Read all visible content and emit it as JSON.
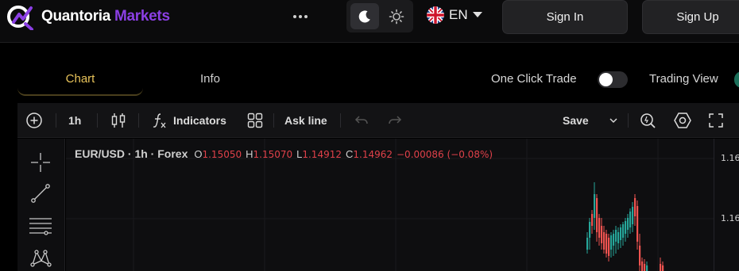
{
  "brand": {
    "name_white": "Quantoria",
    "name_purple": " Markets",
    "accent_purple": "#8b3fe4",
    "accent_gold": "#e8c35a"
  },
  "header": {
    "more_icon": "more-horizontal-icon",
    "theme": {
      "dark_icon": "moon-icon",
      "light_icon": "sun-icon",
      "active": "dark"
    },
    "language": {
      "flag_icon": "uk-flag-icon",
      "label": "EN",
      "caret_icon": "caret-down-icon"
    },
    "sign_in": "Sign In",
    "sign_up": "Sign Up"
  },
  "tabs": [
    {
      "label": "Chart",
      "active": true
    },
    {
      "label": "Info",
      "active": false
    }
  ],
  "toggles": {
    "one_click_trade": {
      "label": "One Click Trade",
      "on": false
    },
    "trading_view": {
      "label": "Trading View",
      "on": true
    }
  },
  "toolbar": {
    "add_symbol_icon": "plus-circle-icon",
    "interval": "1h",
    "chart_type_icon": "candles-icon",
    "indicators_icon": "fx-icon",
    "indicators": "Indicators",
    "templates_icon": "layout-grid-icon",
    "ask_line": "Ask line",
    "undo_icon": "undo-icon",
    "redo_icon": "redo-icon",
    "save": "Save",
    "save_menu_icon": "chevron-down-icon",
    "quick_search_icon": "quick-search-icon",
    "settings_icon": "hexagon-settings-icon",
    "fullscreen_icon": "fullscreen-icon"
  },
  "drawing_tools": [
    {
      "icon": "crosshair-icon"
    },
    {
      "icon": "trend-line-icon"
    },
    {
      "icon": "fib-retracement-icon"
    },
    {
      "icon": "pattern-icon"
    }
  ],
  "legend": {
    "symbol": "EUR/USD · 1h · Forex",
    "open_label": "O",
    "open": "1.15050",
    "high_label": "H",
    "high": "1.15070",
    "low_label": "L",
    "low": "1.14912",
    "close_label": "C",
    "close": "1.14962",
    "change": "−0.00086 (−0.08%)"
  },
  "price_axis": {
    "ticks": [
      "1.16",
      "1.16"
    ]
  },
  "colors": {
    "up": "#26a69a",
    "down": "#ef5350",
    "background": "#0e0e10"
  }
}
